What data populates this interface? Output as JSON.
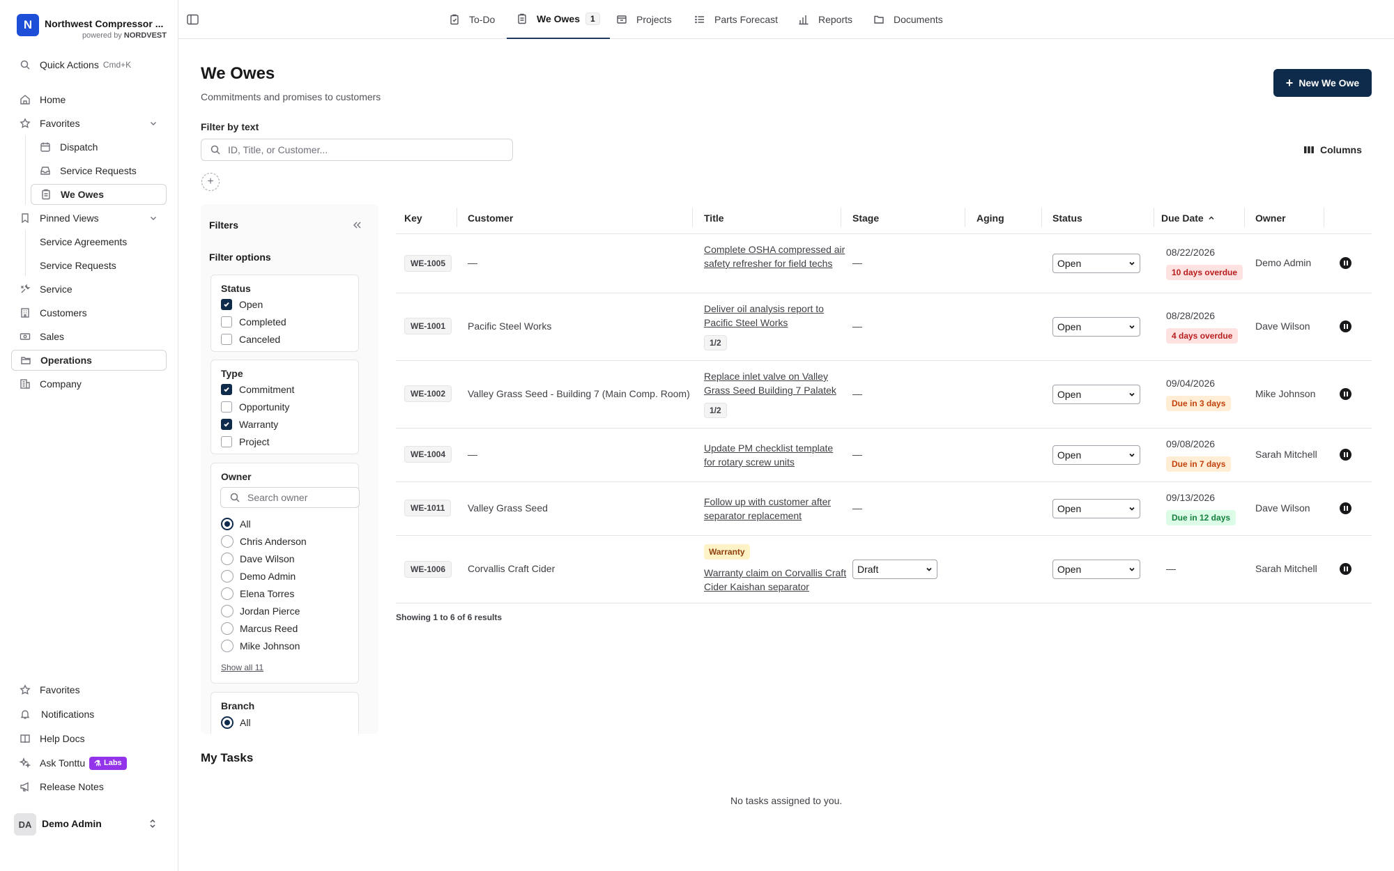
{
  "brand": {
    "logo_letter": "N",
    "name": "Northwest Compressor ...",
    "powered_prefix": "powered by",
    "powered_brand": "NORDVEST"
  },
  "sidebar": {
    "quick_actions": "Quick Actions",
    "quick_actions_kbd": "Cmd+K",
    "home": "Home",
    "favorites": "Favorites",
    "favorites_items": [
      "Dispatch",
      "Service Requests",
      "We Owes"
    ],
    "pinned_views": "Pinned Views",
    "pinned_items": [
      "Service Agreements",
      "Service Requests"
    ],
    "service": "Service",
    "customers": "Customers",
    "sales": "Sales",
    "operations": "Operations",
    "company": "Company",
    "bottom": {
      "favorites": "Favorites",
      "notifications": "Notifications",
      "help": "Help Docs",
      "ask": "Ask Tonttu",
      "labs": "Labs",
      "release": "Release Notes"
    },
    "user": {
      "initials": "DA",
      "name": "Demo Admin"
    }
  },
  "topnav": {
    "tabs": [
      "To-Do",
      "We Owes",
      "Projects",
      "Parts Forecast",
      "Reports",
      "Documents"
    ],
    "we_owes_count": "1"
  },
  "page": {
    "title": "We Owes",
    "subtitle": "Commitments and promises to customers",
    "new_button": "New We Owe",
    "filter_label": "Filter by text",
    "filter_placeholder": "ID, Title, or Customer...",
    "columns": "Columns"
  },
  "filters": {
    "title": "Filters",
    "options_title": "Filter options",
    "status": {
      "label": "Status",
      "options": [
        "Open",
        "Completed",
        "Canceled"
      ]
    },
    "type": {
      "label": "Type",
      "options": [
        "Commitment",
        "Opportunity",
        "Warranty",
        "Project"
      ]
    },
    "owner": {
      "label": "Owner",
      "placeholder": "Search owner",
      "options": [
        "All",
        "Chris Anderson",
        "Dave Wilson",
        "Demo Admin",
        "Elena Torres",
        "Jordan Pierce",
        "Marcus Reed",
        "Mike Johnson"
      ],
      "show_all": "Show all 11"
    },
    "branch": {
      "label": "Branch",
      "options": [
        "All"
      ]
    }
  },
  "table": {
    "headers": [
      "Key",
      "Customer",
      "Title",
      "Stage",
      "Aging",
      "Status",
      "Due Date",
      "Owner"
    ],
    "rows": [
      {
        "key": "WE-1005",
        "customer": "—",
        "title": "Complete OSHA compressed air safety refresher for field techs",
        "stage": "—",
        "status": "Open",
        "due": "08/22/2026",
        "due_note": "10 days overdue",
        "owner": "Demo Admin"
      },
      {
        "key": "WE-1001",
        "customer": "Pacific Steel Works",
        "title": "Deliver oil analysis report to Pacific Steel Works",
        "sub": "1/2",
        "stage": "—",
        "status": "Open",
        "due": "08/28/2026",
        "due_note": "4 days overdue",
        "owner": "Dave Wilson"
      },
      {
        "key": "WE-1002",
        "customer": "Valley Grass Seed - Building 7 (Main Comp. Room)",
        "title": "Replace inlet valve on Valley Grass Seed Building 7 Palatek",
        "sub": "1/2",
        "stage": "—",
        "status": "Open",
        "due": "09/04/2026",
        "due_note": "Due in 3 days",
        "owner": "Mike Johnson"
      },
      {
        "key": "WE-1004",
        "customer": "—",
        "title": "Update PM checklist template for rotary screw units",
        "stage": "—",
        "status": "Open",
        "due": "09/08/2026",
        "due_note": "Due in 7 days",
        "owner": "Sarah Mitchell"
      },
      {
        "key": "WE-1011",
        "customer": "Valley Grass Seed",
        "title": "Follow up with customer after separator replacement",
        "stage": "—",
        "status": "Open",
        "due": "09/13/2026",
        "due_note": "Due in 12 days",
        "owner": "Dave Wilson"
      },
      {
        "key": "WE-1006",
        "customer": "Corvallis Craft Cider",
        "badge": "Warranty",
        "title": "Warranty claim on Corvallis Craft Cider Kaishan separator",
        "stage": "Draft",
        "status": "Open",
        "due": "—",
        "owner": "Sarah Mitchell"
      }
    ],
    "results": "Showing 1 to 6 of 6 results"
  },
  "tasks": {
    "title": "My Tasks",
    "empty": "No tasks assigned to you."
  },
  "colors": {
    "primary": "#0f2b4c",
    "brand": "#1d4ed8",
    "labs": "#9333ea",
    "overdue": "#b91c1c",
    "soon": "#c2410c",
    "ok": "#15803d"
  }
}
